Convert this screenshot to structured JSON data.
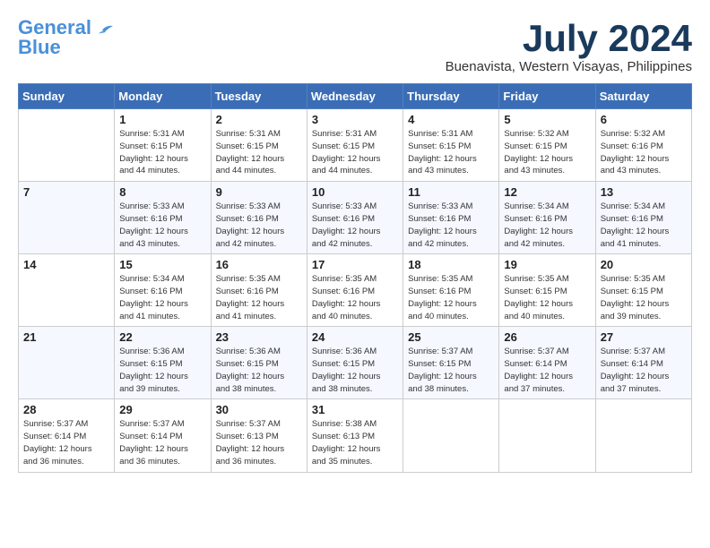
{
  "header": {
    "logo_line1": "General",
    "logo_line2": "Blue",
    "month_year": "July 2024",
    "location": "Buenavista, Western Visayas, Philippines"
  },
  "weekdays": [
    "Sunday",
    "Monday",
    "Tuesday",
    "Wednesday",
    "Thursday",
    "Friday",
    "Saturday"
  ],
  "weeks": [
    [
      {
        "day": "",
        "info": ""
      },
      {
        "day": "1",
        "info": "Sunrise: 5:31 AM\nSunset: 6:15 PM\nDaylight: 12 hours\nand 44 minutes."
      },
      {
        "day": "2",
        "info": "Sunrise: 5:31 AM\nSunset: 6:15 PM\nDaylight: 12 hours\nand 44 minutes."
      },
      {
        "day": "3",
        "info": "Sunrise: 5:31 AM\nSunset: 6:15 PM\nDaylight: 12 hours\nand 44 minutes."
      },
      {
        "day": "4",
        "info": "Sunrise: 5:31 AM\nSunset: 6:15 PM\nDaylight: 12 hours\nand 43 minutes."
      },
      {
        "day": "5",
        "info": "Sunrise: 5:32 AM\nSunset: 6:15 PM\nDaylight: 12 hours\nand 43 minutes."
      },
      {
        "day": "6",
        "info": "Sunrise: 5:32 AM\nSunset: 6:16 PM\nDaylight: 12 hours\nand 43 minutes."
      }
    ],
    [
      {
        "day": "7",
        "info": ""
      },
      {
        "day": "8",
        "info": "Sunrise: 5:33 AM\nSunset: 6:16 PM\nDaylight: 12 hours\nand 43 minutes."
      },
      {
        "day": "9",
        "info": "Sunrise: 5:33 AM\nSunset: 6:16 PM\nDaylight: 12 hours\nand 42 minutes."
      },
      {
        "day": "10",
        "info": "Sunrise: 5:33 AM\nSunset: 6:16 PM\nDaylight: 12 hours\nand 42 minutes."
      },
      {
        "day": "11",
        "info": "Sunrise: 5:33 AM\nSunset: 6:16 PM\nDaylight: 12 hours\nand 42 minutes."
      },
      {
        "day": "12",
        "info": "Sunrise: 5:34 AM\nSunset: 6:16 PM\nDaylight: 12 hours\nand 42 minutes."
      },
      {
        "day": "13",
        "info": "Sunrise: 5:34 AM\nSunset: 6:16 PM\nDaylight: 12 hours\nand 41 minutes."
      }
    ],
    [
      {
        "day": "14",
        "info": ""
      },
      {
        "day": "15",
        "info": "Sunrise: 5:34 AM\nSunset: 6:16 PM\nDaylight: 12 hours\nand 41 minutes."
      },
      {
        "day": "16",
        "info": "Sunrise: 5:35 AM\nSunset: 6:16 PM\nDaylight: 12 hours\nand 41 minutes."
      },
      {
        "day": "17",
        "info": "Sunrise: 5:35 AM\nSunset: 6:16 PM\nDaylight: 12 hours\nand 40 minutes."
      },
      {
        "day": "18",
        "info": "Sunrise: 5:35 AM\nSunset: 6:16 PM\nDaylight: 12 hours\nand 40 minutes."
      },
      {
        "day": "19",
        "info": "Sunrise: 5:35 AM\nSunset: 6:15 PM\nDaylight: 12 hours\nand 40 minutes."
      },
      {
        "day": "20",
        "info": "Sunrise: 5:35 AM\nSunset: 6:15 PM\nDaylight: 12 hours\nand 39 minutes."
      }
    ],
    [
      {
        "day": "21",
        "info": ""
      },
      {
        "day": "22",
        "info": "Sunrise: 5:36 AM\nSunset: 6:15 PM\nDaylight: 12 hours\nand 39 minutes."
      },
      {
        "day": "23",
        "info": "Sunrise: 5:36 AM\nSunset: 6:15 PM\nDaylight: 12 hours\nand 38 minutes."
      },
      {
        "day": "24",
        "info": "Sunrise: 5:36 AM\nSunset: 6:15 PM\nDaylight: 12 hours\nand 38 minutes."
      },
      {
        "day": "25",
        "info": "Sunrise: 5:37 AM\nSunset: 6:15 PM\nDaylight: 12 hours\nand 38 minutes."
      },
      {
        "day": "26",
        "info": "Sunrise: 5:37 AM\nSunset: 6:14 PM\nDaylight: 12 hours\nand 37 minutes."
      },
      {
        "day": "27",
        "info": "Sunrise: 5:37 AM\nSunset: 6:14 PM\nDaylight: 12 hours\nand 37 minutes."
      }
    ],
    [
      {
        "day": "28",
        "info": "Sunrise: 5:37 AM\nSunset: 6:14 PM\nDaylight: 12 hours\nand 36 minutes."
      },
      {
        "day": "29",
        "info": "Sunrise: 5:37 AM\nSunset: 6:14 PM\nDaylight: 12 hours\nand 36 minutes."
      },
      {
        "day": "30",
        "info": "Sunrise: 5:37 AM\nSunset: 6:13 PM\nDaylight: 12 hours\nand 36 minutes."
      },
      {
        "day": "31",
        "info": "Sunrise: 5:38 AM\nSunset: 6:13 PM\nDaylight: 12 hours\nand 35 minutes."
      },
      {
        "day": "",
        "info": ""
      },
      {
        "day": "",
        "info": ""
      },
      {
        "day": "",
        "info": ""
      }
    ]
  ]
}
